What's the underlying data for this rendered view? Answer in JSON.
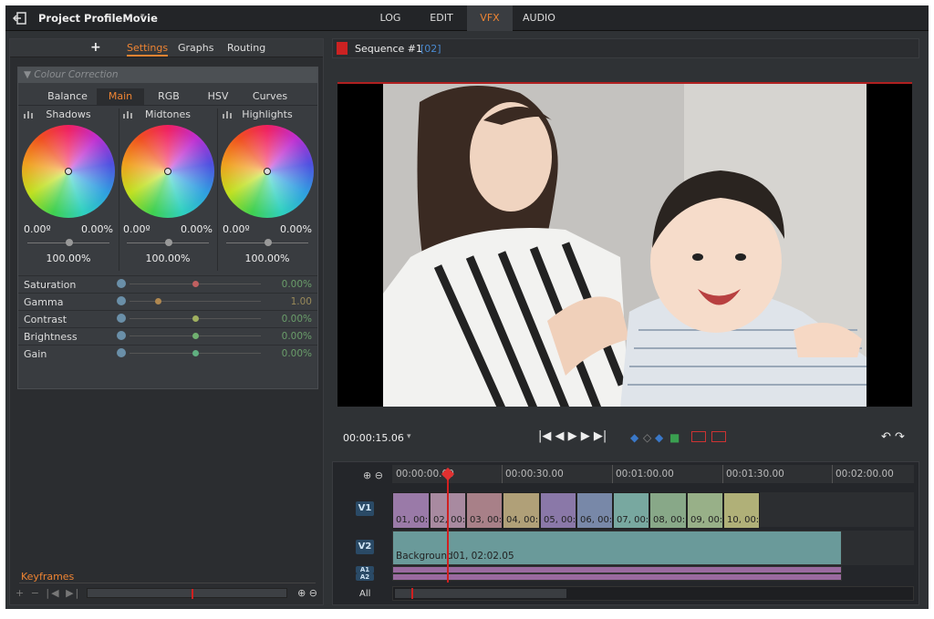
{
  "topbar": {
    "project_title": "Project ProfileMovie",
    "caret": "▾",
    "tabs": [
      {
        "label": "LOG",
        "active": false
      },
      {
        "label": "EDIT",
        "active": false
      },
      {
        "label": "VFX",
        "active": true
      },
      {
        "label": "AUDIO",
        "active": false
      }
    ]
  },
  "left_panel": {
    "add_label": "+",
    "tabs": [
      {
        "label": "Settings",
        "active": true
      },
      {
        "label": "Graphs",
        "active": false
      },
      {
        "label": "Routing",
        "active": false
      }
    ],
    "colour_correction": {
      "header": "▼ Colour Correction",
      "tabs": [
        {
          "label": "Balance",
          "active": false
        },
        {
          "label": "Main",
          "active": true
        },
        {
          "label": "RGB",
          "active": false
        },
        {
          "label": "HSV",
          "active": false
        },
        {
          "label": "Curves",
          "active": false
        }
      ],
      "wheels": [
        {
          "title": "Shadows",
          "angle": "0.00º",
          "amount": "0.00%",
          "level": "100.00%"
        },
        {
          "title": "Midtones",
          "angle": "0.00º",
          "amount": "0.00%",
          "level": "100.00%"
        },
        {
          "title": "Highlights",
          "angle": "0.00º",
          "amount": "0.00%",
          "level": "100.00%"
        }
      ],
      "adjustments": [
        {
          "label": "Saturation",
          "value": "0.00%",
          "knob_color": "#c06060",
          "position": 0.5
        },
        {
          "label": "Gamma",
          "value": "1.00",
          "knob_color": "#b08850",
          "position": 0.22
        },
        {
          "label": "Contrast",
          "value": "0.00%",
          "knob_color": "#a0b060",
          "position": 0.5
        },
        {
          "label": "Brightness",
          "value": "0.00%",
          "knob_color": "#70b070",
          "position": 0.5
        },
        {
          "label": "Gain",
          "value": "0.00%",
          "knob_color": "#60b080",
          "position": 0.5
        }
      ]
    },
    "keyframes": {
      "label": "Keyframes",
      "icons": "+ − |◀ ▶|",
      "zoom_icons": "⊕ ⊖"
    }
  },
  "viewer": {
    "sequence_title": "Sequence #1",
    "sequence_num": "[02]",
    "timecode": "00:00:15.06",
    "timecode_caret": "▾",
    "transport_icons": "|◀ ◀ ▶ ▶ ▶|",
    "undo_icons": "↶ ↷"
  },
  "timeline": {
    "zoom_icons": "⊕ ⊖",
    "ruler_labels": [
      "00:00:00.00",
      "00:00:30.00",
      "00:01:00.00",
      "00:01:30.00",
      "00:02:00.00"
    ],
    "tracks": {
      "v1": "V1",
      "v2": "V2",
      "a1": "A1",
      "a2": "A2",
      "all": "All"
    },
    "v1_clips": [
      {
        "label": "01, 00:",
        "color": "#9a7aa8"
      },
      {
        "label": "02, 00:",
        "color": "#a88aa0"
      },
      {
        "label": "03, 00:",
        "color": "#a88088"
      },
      {
        "label": "04, 00:",
        "color": "#b0a078"
      },
      {
        "label": "05, 00:",
        "color": "#8a78a8"
      },
      {
        "label": "06, 00:",
        "color": "#7888a8"
      },
      {
        "label": "07, 00:",
        "color": "#78a8a0"
      },
      {
        "label": "08, 00:",
        "color": "#88a888"
      },
      {
        "label": "09, 00:",
        "color": "#98b088"
      },
      {
        "label": "10, 00:",
        "color": "#b0b078"
      }
    ],
    "v2_clip": "Background01, 02:02.05"
  }
}
